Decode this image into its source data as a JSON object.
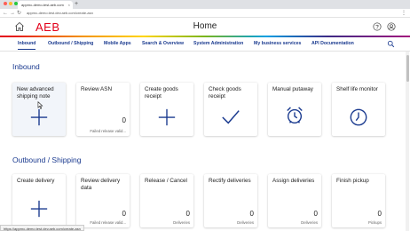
{
  "browser": {
    "tab_title": "apprnc-demo-test.aeb.com",
    "tab_close": "×",
    "new_tab": "+",
    "back": "←",
    "forward": "→",
    "reload": "↻",
    "url": "apprnc-demo.test.dev.aeb.com/create-asn",
    "menu": "⋮"
  },
  "header": {
    "logo": "AEB",
    "title": "Home",
    "brand_color": "#e2001a"
  },
  "nav": {
    "items": [
      "Inbound",
      "Outbound / Shipping",
      "Mobile Apps",
      "Search & Overview",
      "System Administration",
      "My business services",
      "API Documentation"
    ],
    "active_index": 0,
    "accent": "#1a3a8f"
  },
  "inbound": {
    "title": "Inbound",
    "cards": [
      {
        "title": "New advanced shipping note",
        "icon": "plus-icon"
      },
      {
        "title": "Review ASN",
        "count": "0",
        "sub": "Failed release valid..."
      },
      {
        "title": "Create goods receipt",
        "icon": "plus-icon"
      },
      {
        "title": "Check goods receipt",
        "icon": "checkmark-icon"
      },
      {
        "title": "Manual putaway",
        "icon": "alarm-clock-icon"
      },
      {
        "title": "Shelf life monitor",
        "icon": "clock-icon"
      }
    ]
  },
  "outbound": {
    "title": "Outbound / Shipping",
    "cards": [
      {
        "title": "Create delivery",
        "icon": "plus-icon"
      },
      {
        "title": "Review delivery data",
        "count": "0",
        "sub": "Failed release valid..."
      },
      {
        "title": "Release / Cancel",
        "count": "0",
        "sub": "Deliveries"
      },
      {
        "title": "Rectify deliveries",
        "count": "0",
        "sub": "Deliveries"
      },
      {
        "title": "Assign deliveries",
        "count": "0",
        "sub": "Deliveries"
      },
      {
        "title": "Finish pickup",
        "count": "0",
        "sub": "Pickups"
      }
    ]
  },
  "status_url": "https://apprnc-demo.test.dev.aeb.com/create-asn"
}
